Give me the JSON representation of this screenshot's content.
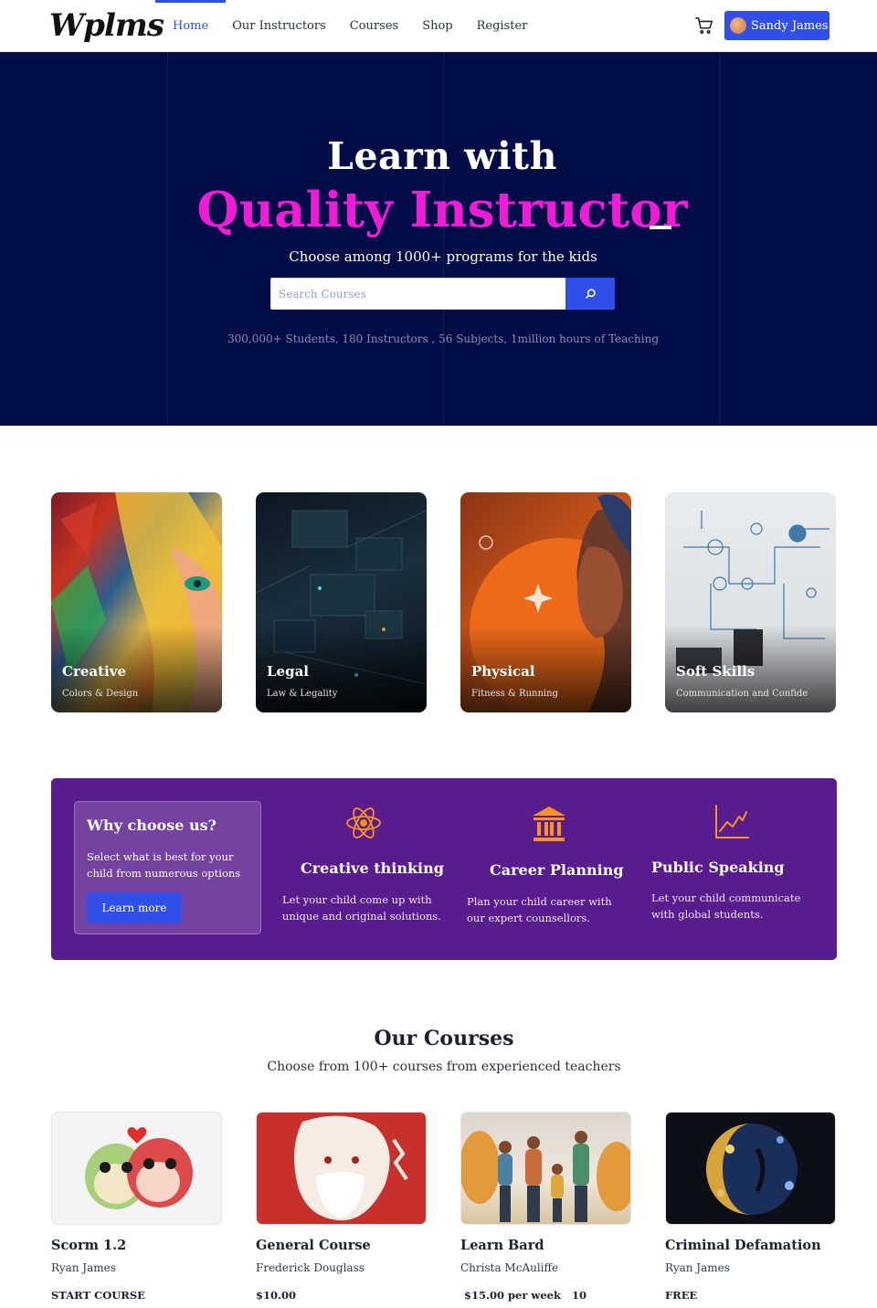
{
  "brand": {
    "logo": "Wplms",
    "accent": "#2f4fe8",
    "hero_bg": "#020c47",
    "highlight": "#f01bd6",
    "why_bg": "#591c8e"
  },
  "nav": {
    "items": [
      "Home",
      "Our Instructors",
      "Courses",
      "Shop",
      "Register"
    ],
    "active": "Home"
  },
  "user": {
    "name": "Sandy James"
  },
  "hero": {
    "title_line1": "Learn with",
    "title_line2": "Quality Instructor",
    "subtitle": "Choose among 1000+ programs for the kids",
    "search_placeholder": "Search Courses",
    "stats": "300,000+ Students, 180 Instructors , 56 Subjects, 1million hours of Teaching"
  },
  "categories": [
    {
      "title": "Creative",
      "subtitle": "Colors & Design"
    },
    {
      "title": "Legal",
      "subtitle": "Law & Legality"
    },
    {
      "title": "Physical",
      "subtitle": "Fitness & Running"
    },
    {
      "title": "Soft Skills",
      "subtitle": "Communication and Confide"
    }
  ],
  "why": {
    "title": "Why choose us?",
    "text": "Select what is best for your child from numerous options",
    "button": "Learn more",
    "features": [
      {
        "icon": "atom-icon",
        "title": "Creative thinking",
        "text": "Let your child come up with unique and original solutions."
      },
      {
        "icon": "institution-icon",
        "title": "Career Planning",
        "text": "Plan your child career with our expert counsellors."
      },
      {
        "icon": "line-chart-icon",
        "title": "Public Speaking",
        "text": "Let your child communicate with global students."
      }
    ]
  },
  "courses": {
    "title": "Our Courses",
    "subtitle": "Choose from 100+ courses from experienced teachers",
    "items": [
      {
        "name": "Scorm 1.2",
        "author": "Ryan James",
        "price": "START COURSE"
      },
      {
        "name": "General Course",
        "author": "Frederick Douglass",
        "price": "$10.00"
      },
      {
        "name": "Learn Bard",
        "author": "Christa McAuliffe",
        "price": "$15.00 per week   10"
      },
      {
        "name": "Criminal Defamation",
        "author": "Ryan James",
        "price": "FREE"
      }
    ]
  }
}
